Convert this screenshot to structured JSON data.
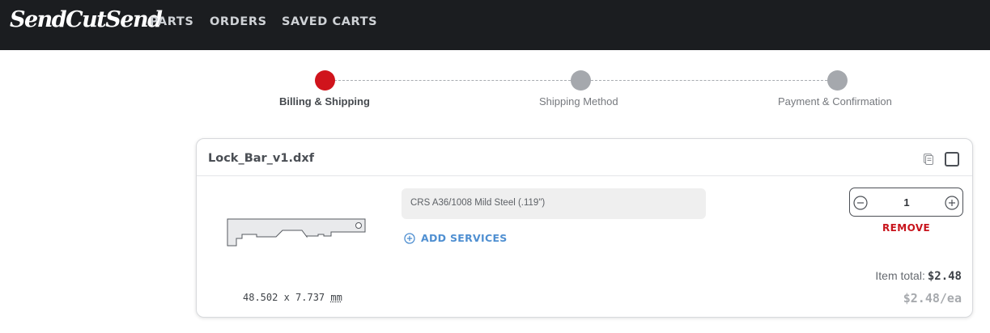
{
  "nav": {
    "logo": "SendCutSend",
    "links": [
      "PARTS",
      "ORDERS",
      "SAVED CARTS"
    ]
  },
  "steps": [
    {
      "label": "Billing & Shipping",
      "state": "active"
    },
    {
      "label": "Shipping Method",
      "state": "pending"
    },
    {
      "label": "Payment & Confirmation",
      "state": "pending"
    }
  ],
  "colors": {
    "nav_bg": "#1b1d20",
    "active_step": "#d0141c",
    "pending_step": "#a5a8ad",
    "link_blue": "#4f8fd1",
    "remove_red": "#c8141c"
  },
  "part": {
    "filename": "Lock_Bar_v1.dxf",
    "material": "CRS A36/1008 Mild Steel (.119\")",
    "add_services_label": "ADD SERVICES",
    "quantity": "1",
    "remove_label": "REMOVE",
    "dims": "48.502 x 7.737",
    "dims_unit": "mm",
    "item_total_label": "Item total:",
    "item_total_value": "$2.48",
    "unit_price": "$2.48/ea",
    "icons": [
      "copy-icon",
      "checkbox",
      "minus-circle-icon",
      "plus-circle-icon",
      "add-circle-icon"
    ]
  }
}
